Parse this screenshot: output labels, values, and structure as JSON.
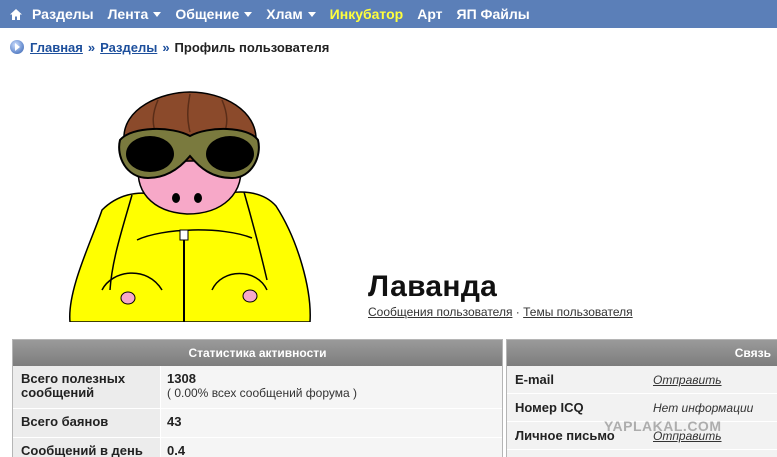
{
  "nav": {
    "home_icon": "home-icon",
    "items": [
      {
        "label": "Разделы",
        "dropdown": false,
        "highlight": false
      },
      {
        "label": "Лента",
        "dropdown": true,
        "highlight": false
      },
      {
        "label": "Общение",
        "dropdown": true,
        "highlight": false
      },
      {
        "label": "Хлам",
        "dropdown": true,
        "highlight": false
      },
      {
        "label": "Инкубатор",
        "dropdown": false,
        "highlight": true
      },
      {
        "label": "Арт",
        "dropdown": false,
        "highlight": false
      },
      {
        "label": "ЯП Файлы",
        "dropdown": false,
        "highlight": false
      }
    ],
    "bar_color": "#5b7fb8",
    "highlight_color": "#ffff3c"
  },
  "breadcrumb": {
    "home": "Главная",
    "sep": "»",
    "sections": "Разделы",
    "current": "Профиль пользователя"
  },
  "profile": {
    "username": "Лаванда",
    "link_posts": "Сообщения пользователя",
    "link_sep": "·",
    "link_topics": "Темы пользователя"
  },
  "stats": {
    "title": "Статистика активности",
    "rows": [
      {
        "label": "Всего полезных сообщений",
        "value": "1308",
        "sub": "( 0.00% всех сообщений форума )"
      },
      {
        "label": "Всего баянов",
        "value": "43",
        "sub": ""
      },
      {
        "label": "Сообщений в день",
        "value": "0.4",
        "sub": ""
      }
    ]
  },
  "contact": {
    "title": "Связь",
    "rows": [
      {
        "label": "E-mail",
        "value": "Отправить",
        "link": true
      },
      {
        "label": "Номер ICQ",
        "value": "Нет информации",
        "link": false
      },
      {
        "label": "Личное письмо",
        "value": "Отправить",
        "link": true
      }
    ]
  },
  "watermark": "YAPLAKAL.COM"
}
